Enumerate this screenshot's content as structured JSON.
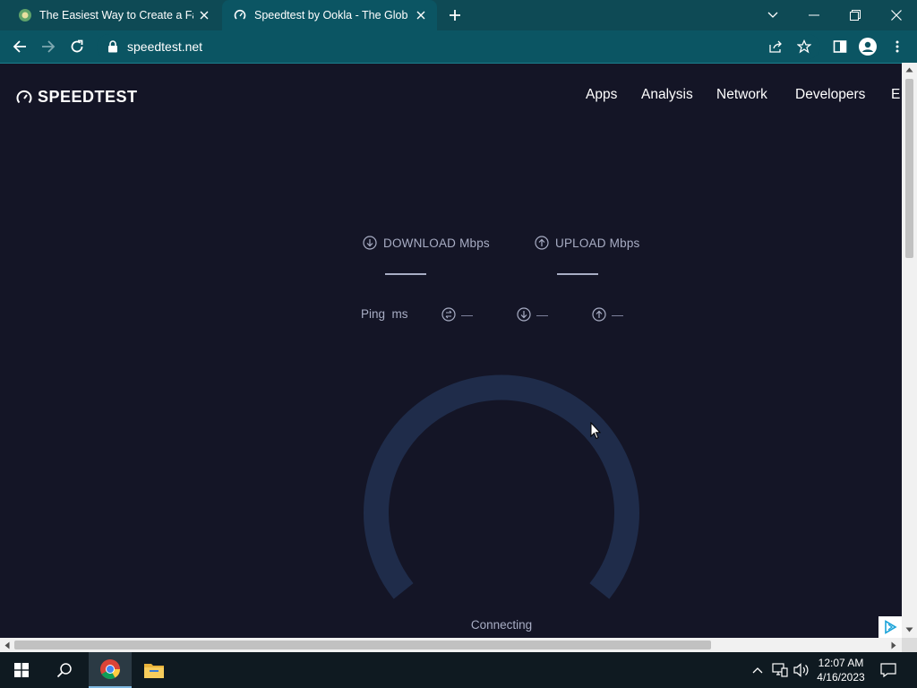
{
  "browser": {
    "tabs": [
      {
        "title": "The Easiest Way to Create a Fake",
        "active": false
      },
      {
        "title": "Speedtest by Ookla - The Global",
        "active": true
      }
    ],
    "url": "speedtest.net"
  },
  "site": {
    "logo": "SPEEDTEST",
    "nav": [
      "Apps",
      "Analysis",
      "Network",
      "Developers",
      "E"
    ]
  },
  "metrics": {
    "download_label": "DOWNLOAD",
    "download_unit": "Mbps",
    "upload_label": "UPLOAD",
    "upload_unit": "Mbps",
    "ping_label": "Ping",
    "ping_unit": "ms",
    "ping_idle": "—",
    "ping_down": "—",
    "ping_up": "—"
  },
  "status": "Connecting",
  "taskbar": {
    "time": "12:07 AM",
    "date": "4/16/2023"
  },
  "colors": {
    "page_bg": "#141526",
    "gauge_track": "#1f2c4a",
    "chrome_bg": "#0b5563"
  }
}
